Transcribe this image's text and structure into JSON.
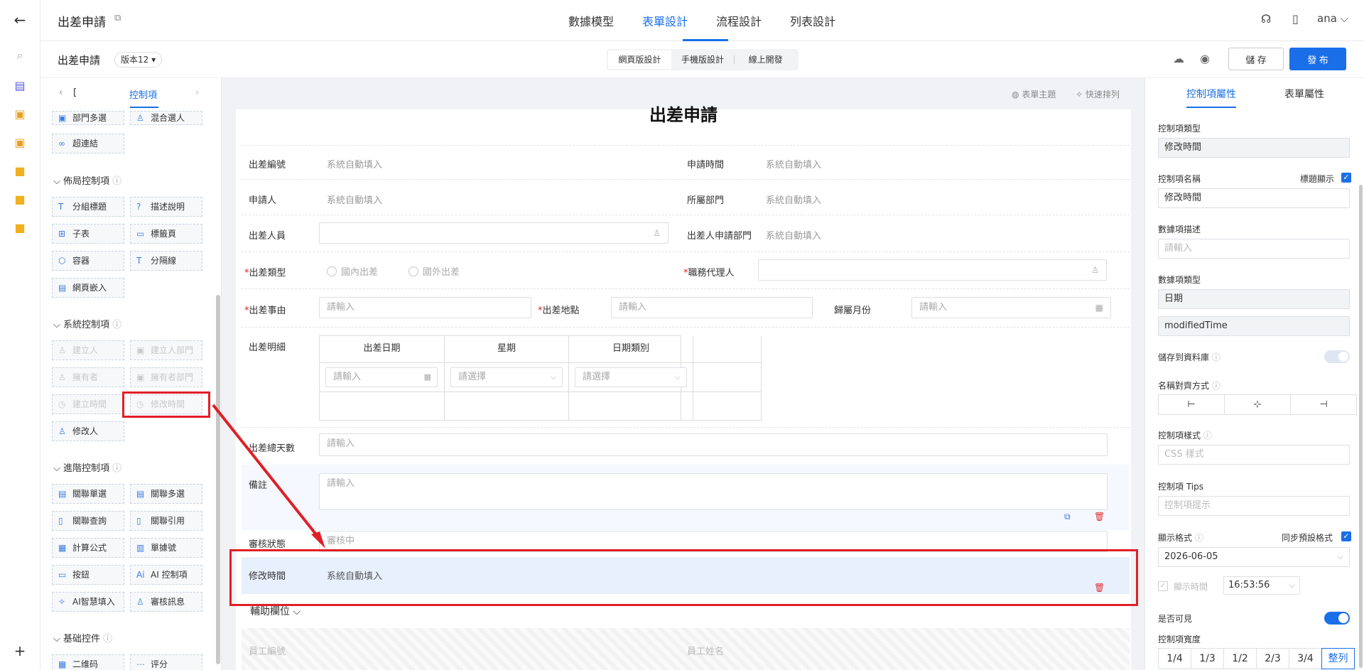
{
  "header": {
    "title": "出差申請",
    "tabs": [
      "數據模型",
      "表單設計",
      "流程設計",
      "列表設計"
    ],
    "active_tab": "表單設計",
    "user": "ana"
  },
  "subbar": {
    "form_name": "出差申請",
    "version": "版本12",
    "modes": [
      "網頁版設計",
      "手機版設計",
      "線上開發"
    ],
    "save": "儲 存",
    "publish": "發 布"
  },
  "palette": {
    "tab_left": "[",
    "tab_active": "控制項",
    "top_items": [
      "部門多選",
      "混合選人",
      "超連結"
    ],
    "layout": {
      "title": "佈局控制項",
      "items": [
        "分組標題",
        "描述說明",
        "子表",
        "標籤頁",
        "容器",
        "分隔線",
        "網頁嵌入"
      ]
    },
    "system": {
      "title": "系統控制項",
      "items": [
        "建立人",
        "建立人部門",
        "擁有者",
        "擁有者部門",
        "建立時間",
        "修改時間",
        "修改人"
      ]
    },
    "advanced": {
      "title": "進階控制項",
      "items": [
        "關聯單選",
        "關聯多選",
        "關聯查詢",
        "關聯引用",
        "計算公式",
        "單據號",
        "按鈕",
        "AI 控制項",
        "AI智慧填入",
        "審核訊息"
      ]
    },
    "basic": {
      "title": "基础控件",
      "items": [
        "二维码",
        "评分"
      ]
    }
  },
  "canvas": {
    "theme": "表單主題",
    "quick": "快速排列",
    "form_title": "出差申請",
    "auto": "系統自動填入",
    "input_ph": "請輸入",
    "select_ph": "請選擇",
    "fields": {
      "no": "出差編號",
      "apply_time": "申請時間",
      "applicant": "申請人",
      "dept": "所屬部門",
      "travelers": "出差人員",
      "traveler_dept": "出差人申請部門",
      "type": "出差類型",
      "agent": "職務代理人",
      "reason": "出差事由",
      "place": "出差地點",
      "month": "歸屬月份",
      "detail": "出差明細",
      "days": "出差總天數",
      "remark": "備註",
      "status": "審核狀態",
      "modified": "修改時間"
    },
    "radio": [
      "國內出差",
      "國外出差"
    ],
    "detail_cols": [
      "出差日期",
      "星期",
      "日期類別"
    ],
    "status_value": "審核中",
    "aux": {
      "title": "輔助欄位",
      "f1": "員工編號",
      "f2": "員工姓名"
    }
  },
  "props": {
    "tabs": [
      "控制項屬性",
      "表單屬性"
    ],
    "type_label": "控制項類型",
    "type_value": "修改時間",
    "name_label": "控制項名稱",
    "title_show": "標題顯示",
    "name_value": "修改時間",
    "desc_label": "數據項描述",
    "desc_ph": "請輸入",
    "dtype_label": "數據項類型",
    "dtype_value": "日期",
    "field_id": "modifiedTime",
    "store_label": "儲存到資料庫",
    "align_label": "名稱對齊方式",
    "style_label": "控制項樣式",
    "style_ph": "CSS 樣式",
    "tips_label": "控制項 Tips",
    "tips_ph": "控制項提示",
    "fmt_label": "顯示格式",
    "sync_label": "同步預設格式",
    "date_value": "2026-06-05",
    "showtime_label": "顯示時間",
    "time_value": "16:53:56",
    "visible_label": "是否可見",
    "width_label": "控制項寬度",
    "widths": [
      "1/4",
      "1/3",
      "1/2",
      "2/3",
      "3/4",
      "整列"
    ]
  },
  "colors": {
    "accent": "#1a6fe8",
    "annotation": "#e01f26"
  }
}
